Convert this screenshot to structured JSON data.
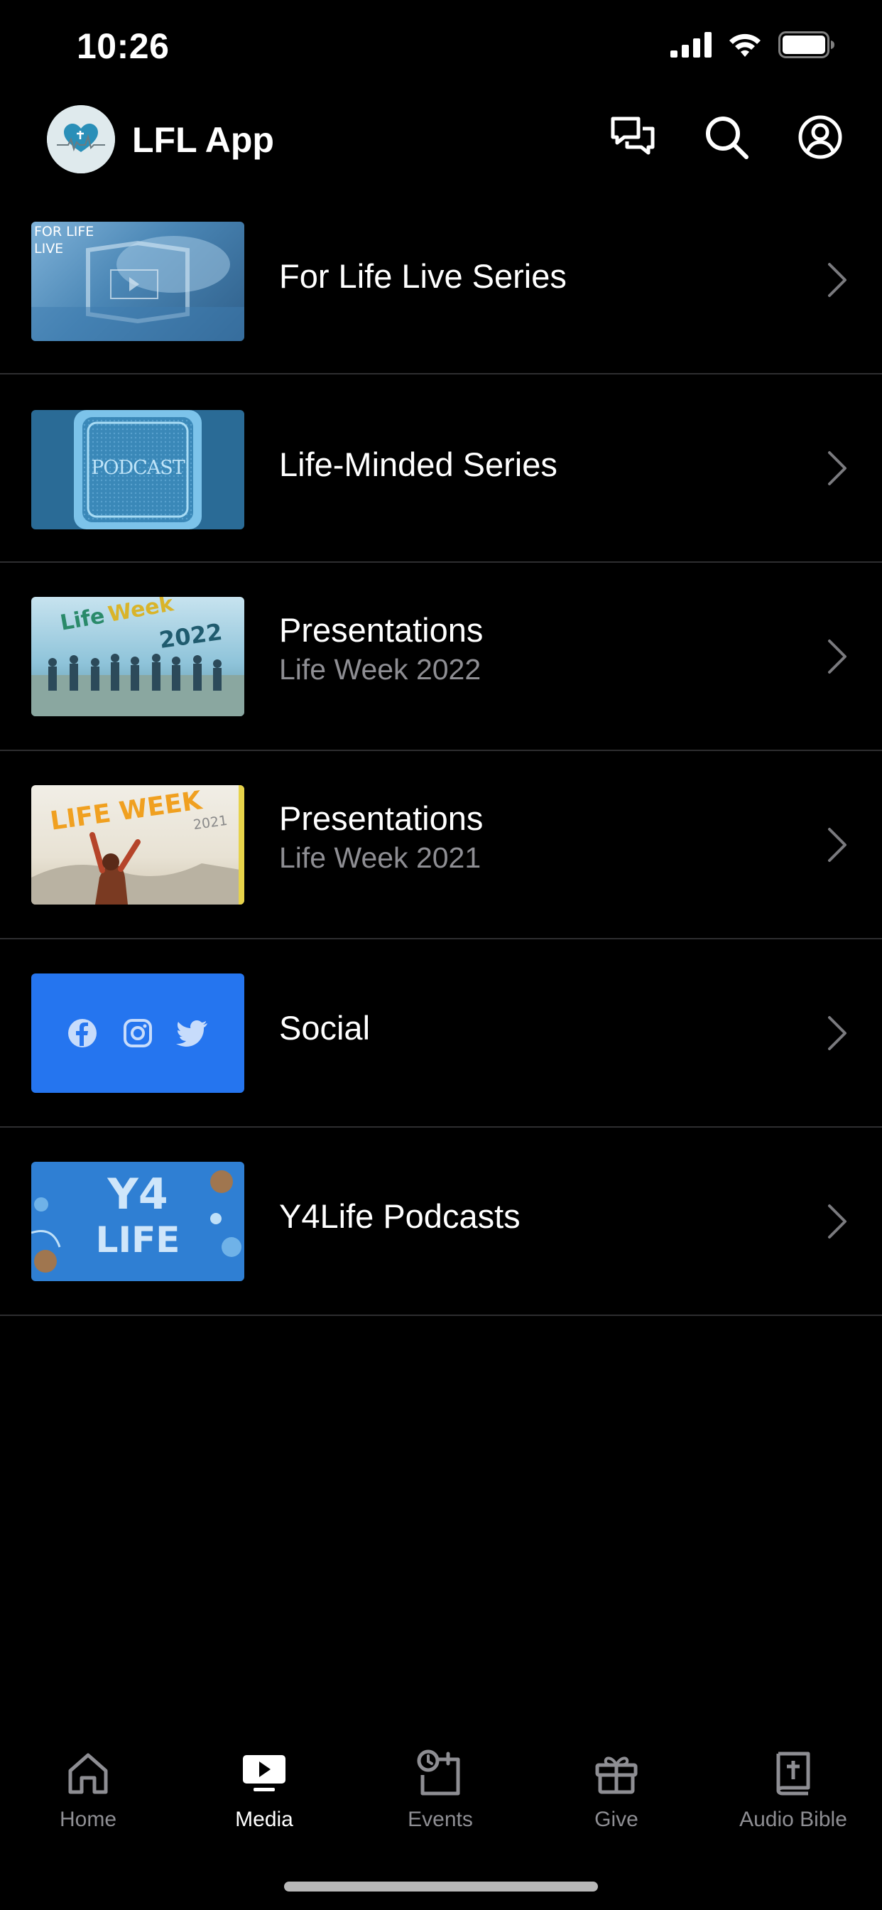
{
  "status_bar": {
    "time": "10:26"
  },
  "header": {
    "app_title": "LFL App",
    "actions": [
      {
        "icon": "chat-icon"
      },
      {
        "icon": "search-icon"
      },
      {
        "icon": "profile-icon"
      }
    ]
  },
  "media": {
    "items": [
      {
        "title": "For Life Live Series",
        "subtitle": "",
        "thumb_text": "FOR LIFE\nLIVE",
        "thumb_line1": "FOR LIFE",
        "thumb_line2": "LIVE"
      },
      {
        "title": "Life-Minded Series",
        "subtitle": "",
        "thumb_text": "PODCAST"
      },
      {
        "title": "Presentations",
        "subtitle": "Life Week 2022",
        "thumb_line1": "Life",
        "thumb_line2": "Week",
        "thumb_line3": "2022"
      },
      {
        "title": "Presentations",
        "subtitle": "Life Week 2021",
        "thumb_line1": "LIFE WEEK",
        "thumb_line2": "2021"
      },
      {
        "title": "Social",
        "subtitle": "",
        "thumb_icons": [
          "facebook-icon",
          "instagram-icon",
          "twitter-icon"
        ]
      },
      {
        "title": "Y4Life Podcasts",
        "subtitle": "",
        "thumb_line1": "Y4",
        "thumb_line2": "LIFE"
      }
    ]
  },
  "tab_bar": {
    "tabs": [
      {
        "label": "Home",
        "icon": "home-icon",
        "active": false
      },
      {
        "label": "Media",
        "icon": "media-icon",
        "active": true
      },
      {
        "label": "Events",
        "icon": "events-icon",
        "active": false
      },
      {
        "label": "Give",
        "icon": "gift-icon",
        "active": false
      },
      {
        "label": "Audio Bible",
        "icon": "bible-icon",
        "active": false
      }
    ]
  },
  "colors": {
    "background": "#000000",
    "text_primary": "#ffffff",
    "text_secondary": "#8e8e93",
    "separator": "#2e2e30",
    "social_blue": "#2575ef",
    "y4life_blue": "#2f7fd3"
  }
}
